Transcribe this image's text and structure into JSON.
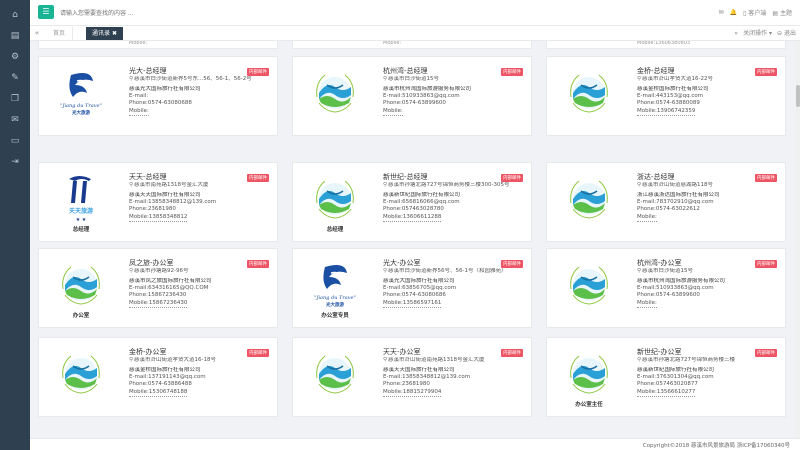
{
  "search": {
    "placeholder": "请输入您需要查找的内容 ..."
  },
  "top_right": {
    "mail_icon": "envelope-icon",
    "bell_icon": "bell-icon",
    "client_label": "客户端",
    "theme_label": "主题"
  },
  "sidebar": {
    "icons": [
      "home-icon",
      "book-icon",
      "gear-icon",
      "edit-icon",
      "file-icon",
      "mail-icon",
      "monitor-icon",
      "exit-icon"
    ]
  },
  "tabs": {
    "home_label": "首页",
    "active_label": "通讯录",
    "close_ops": "关闭操作",
    "exit": "退出"
  },
  "cards": [
    {
      "logo": "guangda",
      "caption": "",
      "title": "光大-总经理",
      "badge": "内部邮件",
      "address": "慈溪市白沙街道新界5号东...56、56-1、56-2号",
      "company": "慈溪光大国际旅行社有限公司",
      "email": "E-mail:",
      "phone": "Phone:0574-63080688",
      "mobile": "Mobile:"
    },
    {
      "logo": "circle",
      "caption": "",
      "title": "杭州湾-总经理",
      "badge": "内部邮件",
      "address": "慈溪市白沙街道15号",
      "company": "慈溪市杭州湾国际旅游服务有限公司",
      "email": "E-mail:510933863@qq.com",
      "phone": "Phone:0574-63899600",
      "mobile": "Mobile:"
    },
    {
      "logo": "circle",
      "caption": "",
      "title": "金桥-总经理",
      "badge": "内部邮件",
      "address": "慈溪市浒山孝贤大道16-22号",
      "company": "慈溪金桥国际旅行社有限公司",
      "email": "E-mail:443153@qq.com",
      "phone": "Phone:0574-63880089",
      "mobile": "Mobile:13906742359"
    },
    {
      "logo": "tiantian",
      "caption": "总经理",
      "title": "天天-总经理",
      "badge": "内部邮件",
      "address": "慈溪市南苑路1318号金汇大厦",
      "company": "慈溪天天国际旅行社有限公司",
      "email": "E-mail:13858348812@139.com",
      "phone": "Phone:23681980",
      "mobile": "Mobile:13858348812"
    },
    {
      "logo": "circle",
      "caption": "总经理",
      "title": "新世纪-总经理",
      "badge": "内部邮件",
      "address": "慈溪市孙塘北路727号锦恒商务楼三楼300-305号",
      "company": "慈溪新世纪国际旅行社有限公司",
      "email": "E-mail:656816066@qq.com",
      "phone": "Phone:057463028780",
      "mobile": "Mobile:13606611288"
    },
    {
      "logo": "circle",
      "caption": "",
      "title": "浙达-总经理",
      "badge": "内部邮件",
      "address": "慈溪市浒山街道慈湖路118号",
      "company": "浙江慈溪浙达国际旅行社有限公司",
      "email": "E-mail:783702910@qq.com",
      "phone": "Phone:0574-63022612",
      "mobile": "Mobile:"
    },
    {
      "logo": "circle",
      "caption": "办公室",
      "title": "凤之旅-办公室",
      "badge": "内部邮件",
      "address": "慈溪市孙塘路92-96号",
      "company": "慈溪市凤之旅国际旅行社有限公司",
      "email": "E-mail:634316165@QQ.COM",
      "phone": "Phone:15867236430",
      "mobile": "Mobile:15867236430"
    },
    {
      "logo": "guangda",
      "caption": "办公室专员",
      "title": "光大-办公室",
      "badge": "内部邮件",
      "address": "慈溪市白沙街道新界56号、56-1号（和园雅苑）",
      "company": "慈溪光大国际旅行社有限公司",
      "email": "E-mail:63856705@qq.com",
      "phone": "Phone:0574-63080686",
      "mobile": "Mobile:13586597161"
    },
    {
      "logo": "circle",
      "caption": "",
      "title": "杭州湾-办公室",
      "badge": "内部邮件",
      "address": "慈溪市白沙街道15号",
      "company": "慈溪市杭州湾国际旅游服务有限公司",
      "email": "E-mail:510933863@qq.com",
      "phone": "Phone:0574-63899600",
      "mobile": "Mobile:"
    },
    {
      "logo": "circle",
      "caption": "",
      "title": "金桥-办公室",
      "badge": "内部邮件",
      "address": "慈溪市浒山街道孝贤大道16-18号",
      "company": "慈溪金桥国际旅行社有限公司",
      "email": "E-mail:137191143@qq.com",
      "phone": "Phone:0574-63886488",
      "mobile": "Mobile:15306748188"
    },
    {
      "logo": "circle",
      "caption": "",
      "title": "天天-办公室",
      "badge": "内部邮件",
      "address": "慈溪市浒山街道南苑路1318号金汇大厦",
      "company": "慈溪天天国际旅行社有限公司",
      "email": "E-mail:13858348812@139.com",
      "phone": "Phone:23681980",
      "mobile": "Mobile:18815279904"
    },
    {
      "logo": "circle",
      "caption": "办公室主任",
      "title": "新世纪-办公室",
      "badge": "内部邮件",
      "address": "慈溪市孙塘北路727号锦恒商务楼三楼",
      "company": "慈溪新世纪国际旅行社有限公司",
      "email": "E-mail:376301304@qq.com",
      "phone": "Phone:057463020877",
      "mobile": "Mobile:13566610277"
    }
  ],
  "stub_texts": [
    "Mobile:",
    "Mobile:",
    "Mobile:13606380803"
  ],
  "guangda_logo_text": "\"Jiang du Trave\"",
  "guangda_logo_cn": "光大旅游",
  "tiantian_logo_cn": "天天旅游",
  "footer": {
    "copyright": "Copyright©2018 慈溪市风景旅游局 浙ICP备17060340号"
  }
}
